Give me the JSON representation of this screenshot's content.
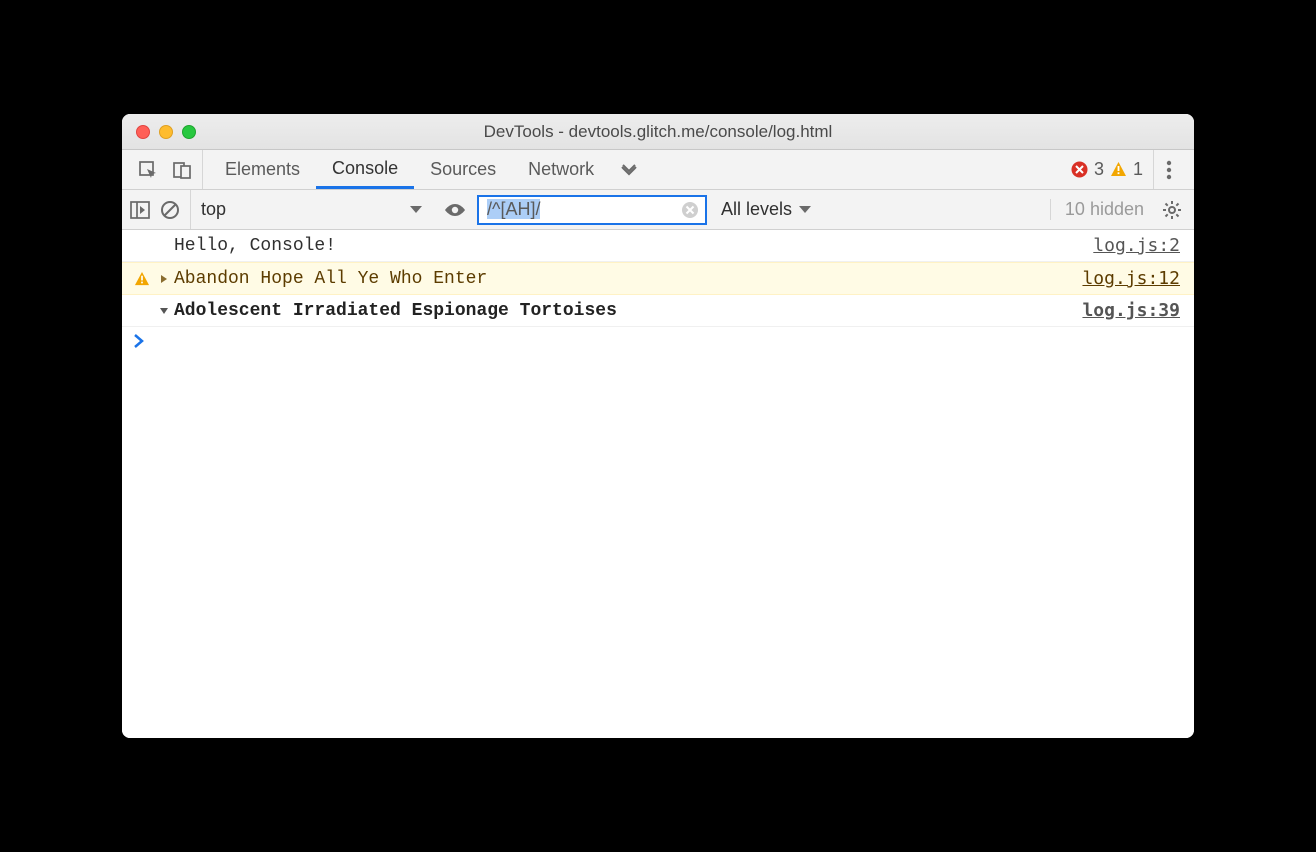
{
  "window": {
    "title": "DevTools - devtools.glitch.me/console/log.html"
  },
  "tabs": {
    "items": [
      "Elements",
      "Console",
      "Sources",
      "Network"
    ],
    "active_index": 1
  },
  "badges": {
    "errors": "3",
    "warnings": "1"
  },
  "filterbar": {
    "context": "top",
    "filter_value": "/^[AH]/",
    "levels_label": "All levels",
    "hidden_label": "10 hidden"
  },
  "console": {
    "rows": [
      {
        "type": "log",
        "message": "Hello, Console!",
        "source": "log.js:2"
      },
      {
        "type": "warn",
        "message": "Abandon Hope All Ye Who Enter",
        "source": "log.js:12"
      },
      {
        "type": "group",
        "message": "Adolescent Irradiated Espionage Tortoises",
        "source": "log.js:39"
      }
    ]
  }
}
